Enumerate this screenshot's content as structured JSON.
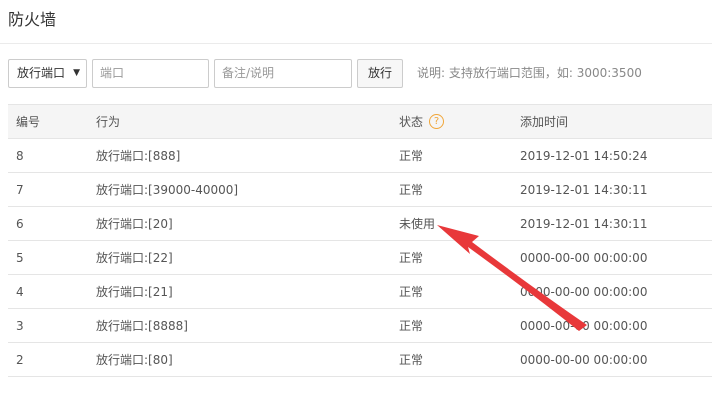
{
  "page": {
    "title": "防火墙"
  },
  "toolbar": {
    "protocol_select": {
      "value": "放行端口"
    },
    "port_input": {
      "placeholder": "端口",
      "value": ""
    },
    "note_input": {
      "placeholder": "备注/说明",
      "value": ""
    },
    "allow_button": "放行",
    "hint": "说明: 支持放行端口范围，如: 3000:3500"
  },
  "table": {
    "headers": {
      "id": "编号",
      "action": "行为",
      "status": "状态",
      "added": "添加时间"
    },
    "status_help_icon": "question-circle-icon",
    "rows": [
      {
        "id": "8",
        "action": "放行端口:[888]",
        "status": "正常",
        "added": "2019-12-01 14:50:24"
      },
      {
        "id": "7",
        "action": "放行端口:[39000-40000]",
        "status": "正常",
        "added": "2019-12-01 14:30:11"
      },
      {
        "id": "6",
        "action": "放行端口:[20]",
        "status": "未使用",
        "added": "2019-12-01 14:30:11"
      },
      {
        "id": "5",
        "action": "放行端口:[22]",
        "status": "正常",
        "added": "0000-00-00 00:00:00"
      },
      {
        "id": "4",
        "action": "放行端口:[21]",
        "status": "正常",
        "added": "0000-00-00 00:00:00"
      },
      {
        "id": "3",
        "action": "放行端口:[8888]",
        "status": "正常",
        "added": "0000-00-00 00:00:00"
      },
      {
        "id": "2",
        "action": "放行端口:[80]",
        "status": "正常",
        "added": "0000-00-00 00:00:00"
      }
    ]
  },
  "annotation": {
    "color": "#e8383a"
  },
  "colors": {
    "help_icon": "#f0a63a",
    "header_bg": "#f5f5f5"
  }
}
